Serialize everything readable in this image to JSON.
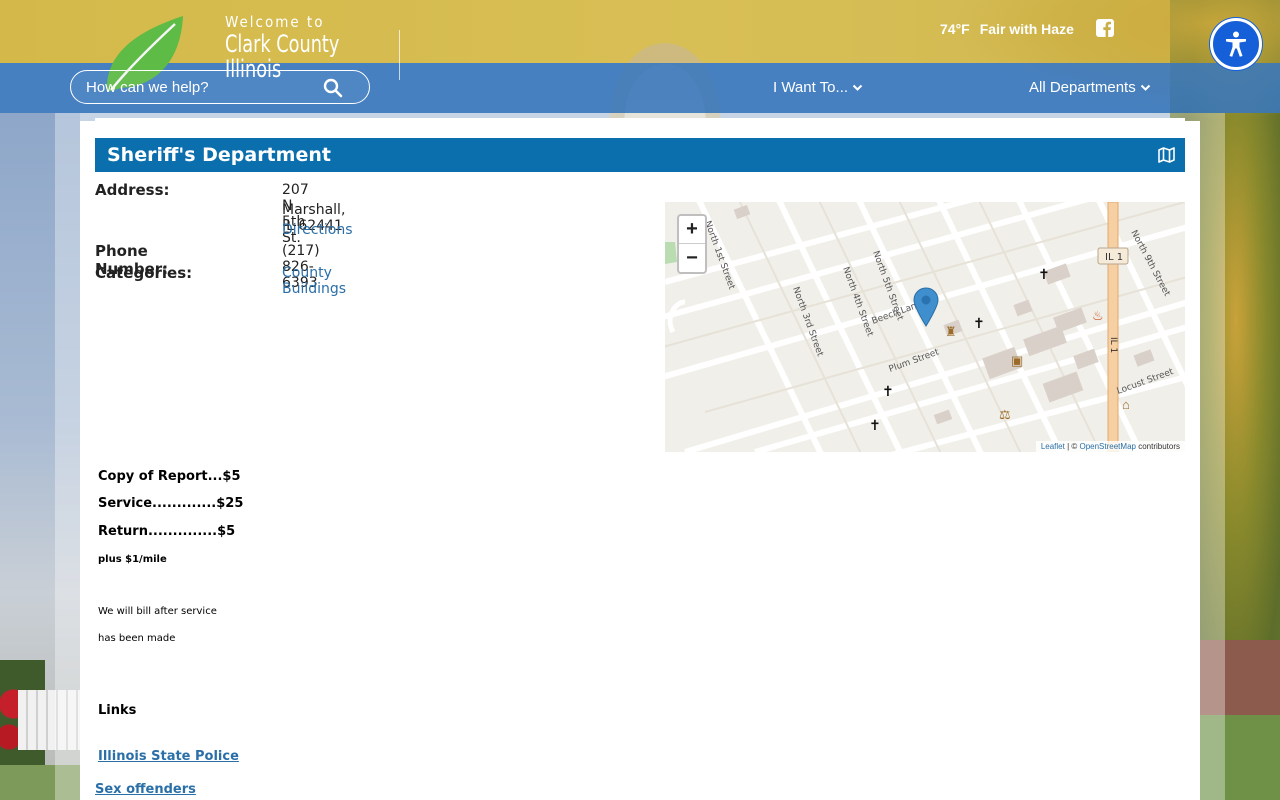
{
  "header": {
    "welcome": "Welcome to",
    "county": "Clark County",
    "state": "Illinois",
    "search_placeholder": "How can we help?",
    "weather_temp": "74°F",
    "weather_desc": "Fair with Haze",
    "nav_i_want_to": "I Want To...",
    "nav_all_departments": "All Departments"
  },
  "department": {
    "title": "Sheriff's Department",
    "address_label": "Address:",
    "address_line1": "207 N 5th St.",
    "address_line2": "Marshall, IL 62441",
    "directions_label": "Directions",
    "phone_label": "Phone Number:",
    "phone": "(217) 826-6393",
    "categories_label": "Categories:",
    "category": "County Buildings"
  },
  "map": {
    "zoom_in": "+",
    "zoom_out": "−",
    "attribution_leaflet": "Leaflet",
    "attribution_sep": " | © ",
    "attribution_osm": "OpenStreetMap",
    "attribution_rest": " contributors",
    "streets": [
      "North 5th Street",
      "North 4th Street",
      "North 3rd Street",
      "Beech Lane",
      "Plum Street",
      "Locust Street",
      "North 9th Street",
      "IL 1"
    ]
  },
  "fees": {
    "copy": "Copy of Report...$5",
    "service": "Service.............$25",
    "return": "Return..............$5",
    "mileage": "plus $1/mile",
    "bill_1": "We will bill after service",
    "bill_2": "has been made"
  },
  "links": {
    "heading": "Links",
    "isp": "Illinois State Police",
    "offenders": "Sex offenders"
  },
  "colors": {
    "title_bar": "#0c6fad",
    "link": "#2a6fa8",
    "accessibility": "#1560d9",
    "nav_bar": "#3977bd"
  }
}
